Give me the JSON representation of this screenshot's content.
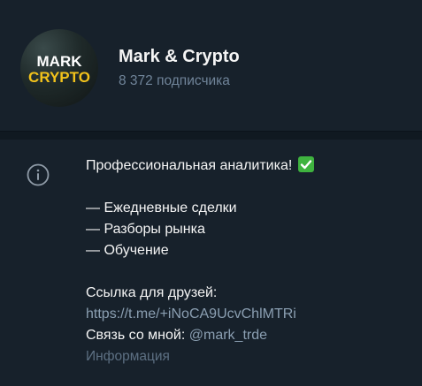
{
  "channel": {
    "name": "Mark & Crypto",
    "subscribers": "8 372 подписчика",
    "avatar": {
      "line1": "MARK",
      "line2": "CRYPTO"
    }
  },
  "info": {
    "icon": "info-icon",
    "headline": "Профессиональная аналитика!",
    "headline_emoji": "check-mark-button-icon",
    "items": [
      "— Ежедневные сделки",
      "— Разборы рынка",
      "— Обучение"
    ],
    "friends_label": "Ссылка для друзей:",
    "friends_link": "https://t.me/+iNoCA9UcvChlMTRi",
    "contact_label": "Связь со мной: ",
    "contact_handle": "@mark_trde",
    "caption": "Информация"
  },
  "colors": {
    "background": "#17212b",
    "divider": "#101921",
    "primary_text": "#f5f5f5",
    "secondary_text": "#708499",
    "link_text": "#8b9fb2",
    "caption_text": "#5d7083",
    "avatar_yellow": "#f2c21b",
    "check_green": "#3fb33f"
  }
}
